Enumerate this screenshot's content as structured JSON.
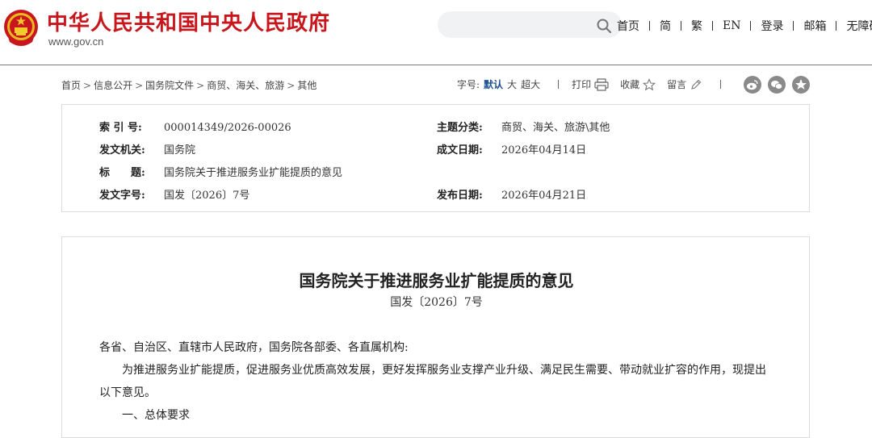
{
  "header": {
    "site_title": "中华人民共和国中央人民政府",
    "site_url": "www.gov.cn",
    "search_placeholder": "",
    "nav": [
      {
        "label": "首页"
      },
      {
        "label": "简"
      },
      {
        "label": "繁"
      },
      {
        "label": "EN"
      },
      {
        "label": "登录"
      },
      {
        "label": "邮箱"
      },
      {
        "label": "无障碍"
      }
    ],
    "brand_color": "#c8161d"
  },
  "breadcrumb": [
    "首页",
    "信息公开",
    "国务院文件",
    "商贸、海关、旅游",
    "其他"
  ],
  "breadcrumb_separator": ">",
  "tools": {
    "font_size_label": "字号:",
    "font_sizes": [
      "默认",
      "大",
      "超大"
    ],
    "active_font_size": "默认",
    "print_label": "打印",
    "favorite_label": "收藏",
    "comment_label": "留言",
    "share_icons": [
      "weibo-icon",
      "wechat-icon",
      "qzone-star-icon"
    ]
  },
  "meta": {
    "index_label": "索 引 号:",
    "index_value": "000014349/2026-00026",
    "issuer_label": "发文机关:",
    "issuer_value": "国务院",
    "subject_label": "标　　题:",
    "subject_value": "国务院关于推进服务业扩能提质的意见",
    "doc_no_label": "发文字号:",
    "doc_no_value": "国发〔2026〕7号",
    "category_label": "主题分类:",
    "category_value": "商贸、海关、旅游\\其他",
    "written_date_label": "成文日期:",
    "written_date_value": "2026年04月14日",
    "published_date_label": "发布日期:",
    "published_date_value": "2026年04月21日"
  },
  "document": {
    "title": "国务院关于推进服务业扩能提质的意见",
    "number": "国发〔2026〕7号",
    "salutation": "各省、自治区、直辖市人民政府，国务院各部委、各直属机构:",
    "intro": "为推进服务业扩能提质，促进服务业优质高效发展，更好发挥服务业支撑产业升级、满足民生需要、带动就业扩容的作用，现提出以下意见。",
    "section_1": "一、总体要求"
  },
  "colors": {
    "accent_blue": "#1d4f91",
    "share_gray": "#8a8a8a",
    "border": "#dcdcdc"
  }
}
